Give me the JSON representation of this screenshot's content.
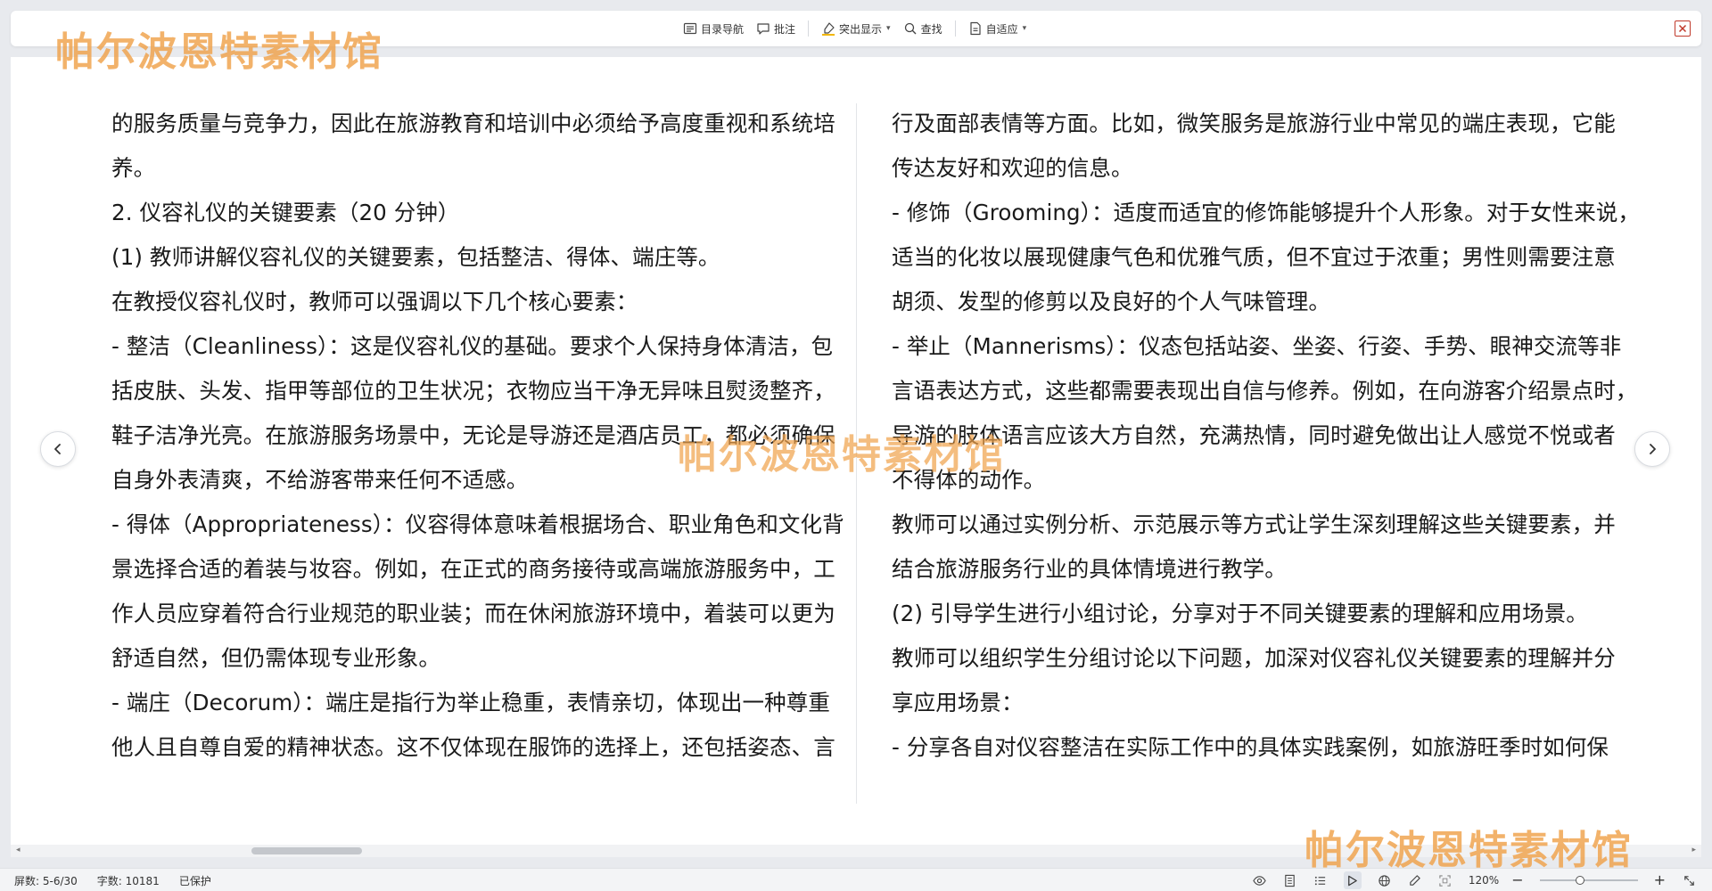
{
  "toolbar": {
    "toc_label": "目录导航",
    "comment_label": "批注",
    "highlight_label": "突出显示",
    "find_label": "查找",
    "fit_label": "自适应"
  },
  "document": {
    "left_lines": [
      "的服务质量与竞争力，因此在旅游教育和培训中必须给予高度重视和系统培",
      "养。",
      "2. 仪容礼仪的关键要素（20 分钟）",
      "(1) 教师讲解仪容礼仪的关键要素，包括整洁、得体、端庄等。",
      "在教授仪容礼仪时，教师可以强调以下几个核心要素：",
      "- 整洁（Cleanliness）：这是仪容礼仪的基础。要求个人保持身体清洁，包",
      "括皮肤、头发、指甲等部位的卫生状况；衣物应当干净无异味且熨烫整齐，",
      "鞋子洁净光亮。在旅游服务场景中，无论是导游还是酒店员工，都必须确保",
      "自身外表清爽，不给游客带来任何不适感。",
      "- 得体（Appropriateness）：仪容得体意味着根据场合、职业角色和文化背",
      "景选择合适的着装与妆容。例如，在正式的商务接待或高端旅游服务中，工",
      "作人员应穿着符合行业规范的职业装；而在休闲旅游环境中，着装可以更为",
      "舒适自然，但仍需体现专业形象。",
      "- 端庄（Decorum）：端庄是指行为举止稳重，表情亲切，体现出一种尊重",
      "他人且自尊自爱的精神状态。这不仅体现在服饰的选择上，还包括姿态、言"
    ],
    "right_lines": [
      "行及面部表情等方面。比如，微笑服务是旅游行业中常见的端庄表现，它能",
      "传达友好和欢迎的信息。",
      "- 修饰（Grooming）：适度而适宜的修饰能够提升个人形象。对于女性来说，",
      "适当的化妆以展现健康气色和优雅气质，但不宜过于浓重；男性则需要注意",
      "胡须、发型的修剪以及良好的个人气味管理。",
      "- 举止（Mannerisms）：仪态包括站姿、坐姿、行姿、手势、眼神交流等非",
      "言语表达方式，这些都需要表现出自信与修养。例如，在向游客介绍景点时，",
      "导游的肢体语言应该大方自然，充满热情，同时避免做出让人感觉不悦或者",
      "不得体的动作。",
      "教师可以通过实例分析、示范展示等方式让学生深刻理解这些关键要素，并",
      "结合旅游服务行业的具体情境进行教学。",
      "(2) 引导学生进行小组讨论，分享对于不同关键要素的理解和应用场景。",
      "教师可以组织学生分组讨论以下问题，加深对仪容礼仪关键要素的理解并分",
      "享应用场景：",
      "- 分享各自对仪容整洁在实际工作中的具体实践案例，如旅游旺季时如何保"
    ]
  },
  "status": {
    "screen": "屏数: 5-6/30",
    "wordcount": "字数: 10181",
    "protected": "已保护",
    "zoom": "120%",
    "zoom_fraction": 0.4
  },
  "watermark": {
    "text": "帕尔波恩特素材馆"
  },
  "colors": {
    "watermark": "#f0a24a",
    "close": "#c0392b"
  }
}
